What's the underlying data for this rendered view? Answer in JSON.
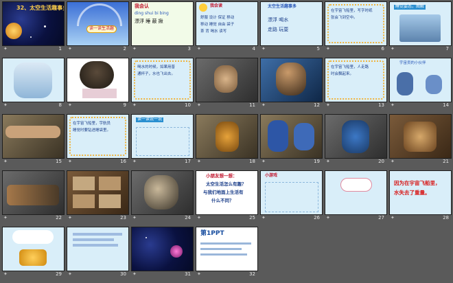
{
  "slides": [
    {
      "n": "1",
      "title": "32、太空生活趣事多"
    },
    {
      "n": "2",
      "title": "读一读生活趣"
    },
    {
      "n": "3",
      "title": "我会认",
      "lines": [
        "ding shui bi bing",
        "漂浮  睡  蔽  揪"
      ]
    },
    {
      "n": "4",
      "title": "我会读",
      "lines": [
        "舒服 设计 保证 移动",
        "移动 睡觉 自由 袋子",
        "茶 背 喝水 读写"
      ]
    },
    {
      "n": "5",
      "title": "太空生活趣事多",
      "lines": [
        "漂浮  喝水",
        "走路  玩耍"
      ]
    },
    {
      "n": "6",
      "title": "",
      "lines": [
        "在宇宙飞船里，写字时纸",
        "张会飞到空中。"
      ]
    },
    {
      "n": "7",
      "title": "睡觉姿态，图解"
    },
    {
      "n": "8",
      "title": ""
    },
    {
      "n": "9",
      "title": ""
    },
    {
      "n": "10",
      "title": "",
      "lines": [
        "喝水的时候，如果用普",
        "通杯子，水也飞出去。"
      ]
    },
    {
      "n": "11",
      "title": ""
    },
    {
      "n": "12",
      "title": ""
    },
    {
      "n": "13",
      "title": "",
      "lines": [
        "在宇宙飞船里，人走路",
        "时会飘起来。"
      ]
    },
    {
      "n": "14",
      "title": "宇宙员的小伙伴"
    },
    {
      "n": "15",
      "title": ""
    },
    {
      "n": "16",
      "title": "",
      "lines": [
        "在宇宙飞船里，宇航员",
        "睡觉时要钻进睡袋里。"
      ]
    },
    {
      "n": "17",
      "title": "读一读说一说"
    },
    {
      "n": "18",
      "title": ""
    },
    {
      "n": "19",
      "title": ""
    },
    {
      "n": "20",
      "title": ""
    },
    {
      "n": "21",
      "title": ""
    },
    {
      "n": "22",
      "title": ""
    },
    {
      "n": "23",
      "title": ""
    },
    {
      "n": "24",
      "title": ""
    },
    {
      "n": "25",
      "title": "小朋友想一想：",
      "lines": [
        "太空生活怎么有趣？",
        "与我们地面上生活有",
        "什么不同？"
      ]
    },
    {
      "n": "26",
      "title": "小游戏"
    },
    {
      "n": "27",
      "title": ""
    },
    {
      "n": "28",
      "title": "",
      "lines": [
        "因为在宇宙飞船里，",
        "水失去了重量。"
      ]
    },
    {
      "n": "29",
      "title": ""
    },
    {
      "n": "30",
      "title": ""
    },
    {
      "n": "31",
      "title": ""
    },
    {
      "n": "32",
      "title": "第1PPT"
    }
  ]
}
